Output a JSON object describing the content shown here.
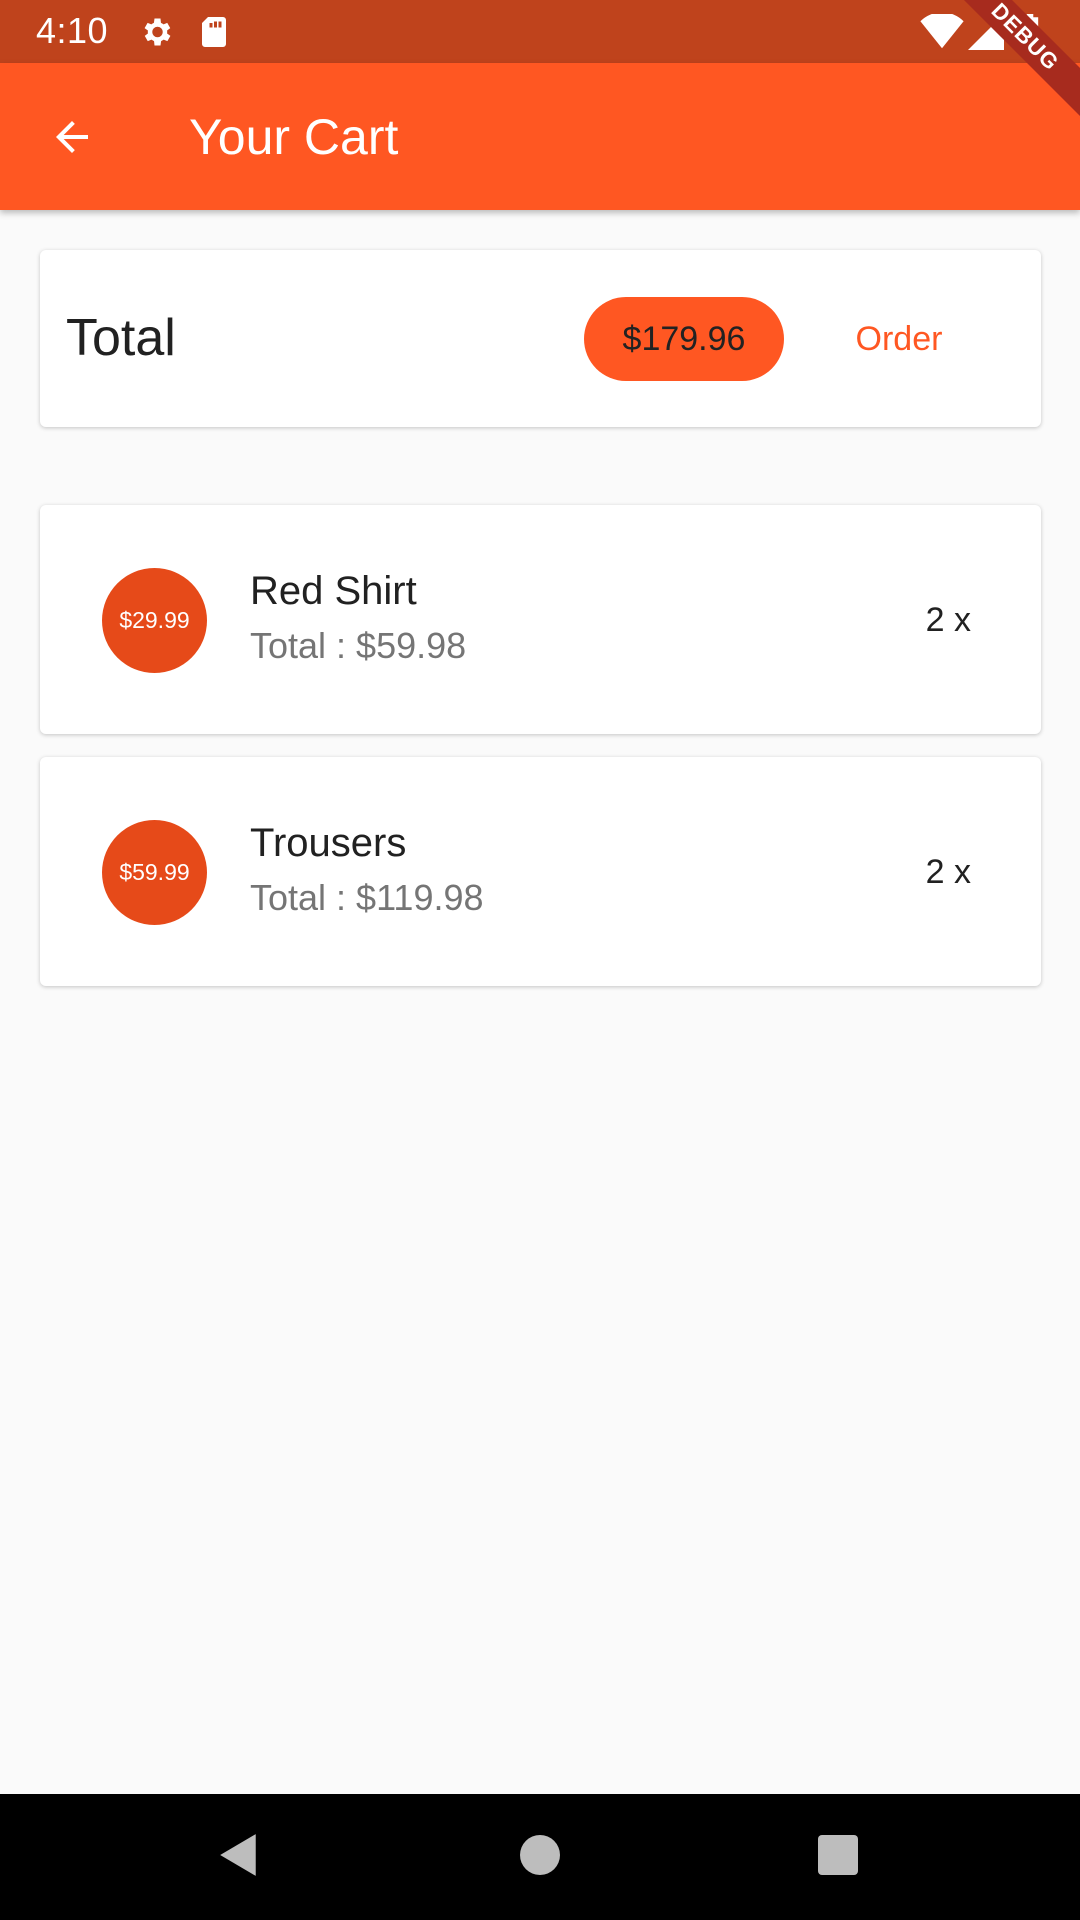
{
  "status_bar": {
    "time": "4:10",
    "icons": [
      "gear-icon",
      "sd-card-icon",
      "wifi-icon",
      "signal-icon",
      "battery-icon"
    ]
  },
  "app_bar": {
    "title": "Your Cart",
    "back_icon": "arrow-back-icon",
    "debug_label": "DEBUG"
  },
  "summary": {
    "total_label": "Total",
    "total_amount": "$179.96",
    "order_label": "Order"
  },
  "cart_items": [
    {
      "price": "$29.99",
      "name": "Red Shirt",
      "total": "Total : $59.98",
      "quantity": "2 x"
    },
    {
      "price": "$59.99",
      "name": "Trousers",
      "total": "Total : $119.98",
      "quantity": "2 x"
    }
  ],
  "colors": {
    "primary": "#ff5722",
    "status_bar": "#bf431c",
    "avatar": "#e64a19",
    "background": "#fafafa"
  },
  "nav_bar": {
    "icons": [
      "back-triangle-icon",
      "home-circle-icon",
      "recents-square-icon"
    ]
  }
}
